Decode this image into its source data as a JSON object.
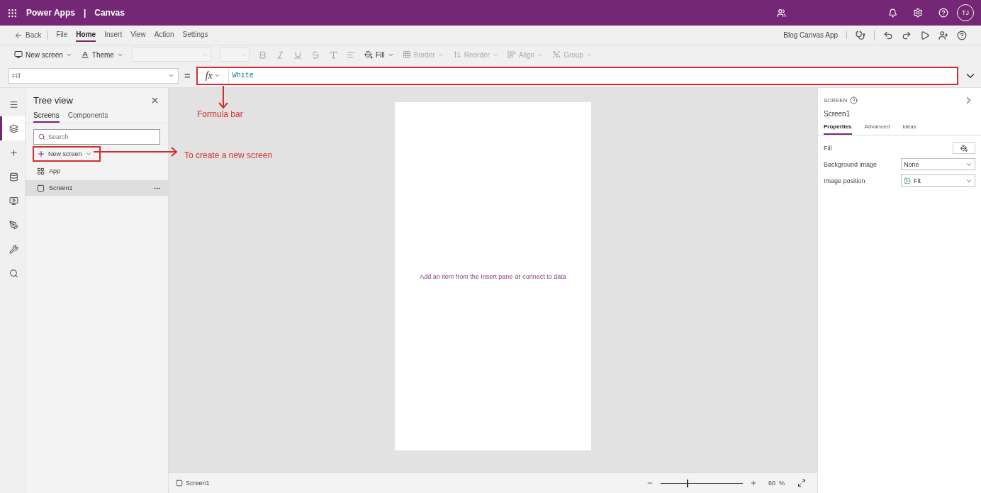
{
  "app_bar": {
    "title": "Power Apps",
    "separator": "|",
    "section": "Canvas",
    "user_initials": "TJ"
  },
  "menu": {
    "back": "Back",
    "tabs": [
      {
        "label": "File",
        "selected": false
      },
      {
        "label": "Home",
        "selected": true
      },
      {
        "label": "Insert",
        "selected": false
      },
      {
        "label": "View",
        "selected": false
      },
      {
        "label": "Action",
        "selected": false
      },
      {
        "label": "Settings",
        "selected": false
      }
    ],
    "app_name": "Blog Canvas App"
  },
  "toolbar": {
    "items": [
      {
        "kind": "new-screen",
        "label": "New screen",
        "disabled": false
      },
      {
        "kind": "theme",
        "label": "Theme",
        "disabled": false
      },
      {
        "kind": "fill",
        "label": "Fill",
        "disabled": false
      },
      {
        "kind": "border",
        "label": "Border",
        "disabled": true
      },
      {
        "kind": "reorder",
        "label": "Reorder",
        "disabled": true
      },
      {
        "kind": "align",
        "label": "Align",
        "disabled": true
      },
      {
        "kind": "group",
        "label": "Group",
        "disabled": true
      }
    ]
  },
  "formula": {
    "property": "Fill",
    "equals": "=",
    "fx": "fx",
    "value": "White"
  },
  "rail": [
    {
      "kind": "menu",
      "selected": false
    },
    {
      "kind": "tree",
      "selected": true
    },
    {
      "kind": "insert",
      "selected": false
    },
    {
      "kind": "data",
      "selected": false
    },
    {
      "kind": "media",
      "selected": false
    },
    {
      "kind": "theme",
      "selected": false
    },
    {
      "kind": "tools",
      "selected": false
    },
    {
      "kind": "search",
      "selected": false
    }
  ],
  "tree": {
    "title": "Tree view",
    "tabs": [
      {
        "label": "Screens",
        "selected": true
      },
      {
        "label": "Components",
        "selected": false
      }
    ],
    "search_placeholder": "Search",
    "new_screen": "New screen",
    "items": [
      {
        "kind": "app",
        "label": "App",
        "selected": false
      },
      {
        "kind": "screen",
        "label": "Screen1",
        "selected": true
      }
    ]
  },
  "canvas": {
    "hint_link": "Add an item from the Insert pane",
    "hint_or": "or",
    "hint_link2": "connect to data"
  },
  "annotations": [
    {
      "kind": "down",
      "text": "Formula bar"
    },
    {
      "kind": "right",
      "text": "To create a new screen"
    }
  ],
  "properties": {
    "kind_label": "SCREEN",
    "name": "Screen1",
    "tabs": [
      {
        "label": "Properties",
        "selected": true
      },
      {
        "label": "Advanced",
        "selected": false
      },
      {
        "label": "Ideas",
        "selected": false
      }
    ],
    "rows": [
      {
        "kind": "color",
        "label": "Fill"
      },
      {
        "kind": "select",
        "label": "Background image",
        "value": "None"
      },
      {
        "kind": "image-select",
        "label": "Image position",
        "value": "Fit"
      }
    ]
  },
  "status_bar": {
    "screen": "Screen1",
    "level": 0.32,
    "zoom": "60",
    "unit": "%"
  }
}
